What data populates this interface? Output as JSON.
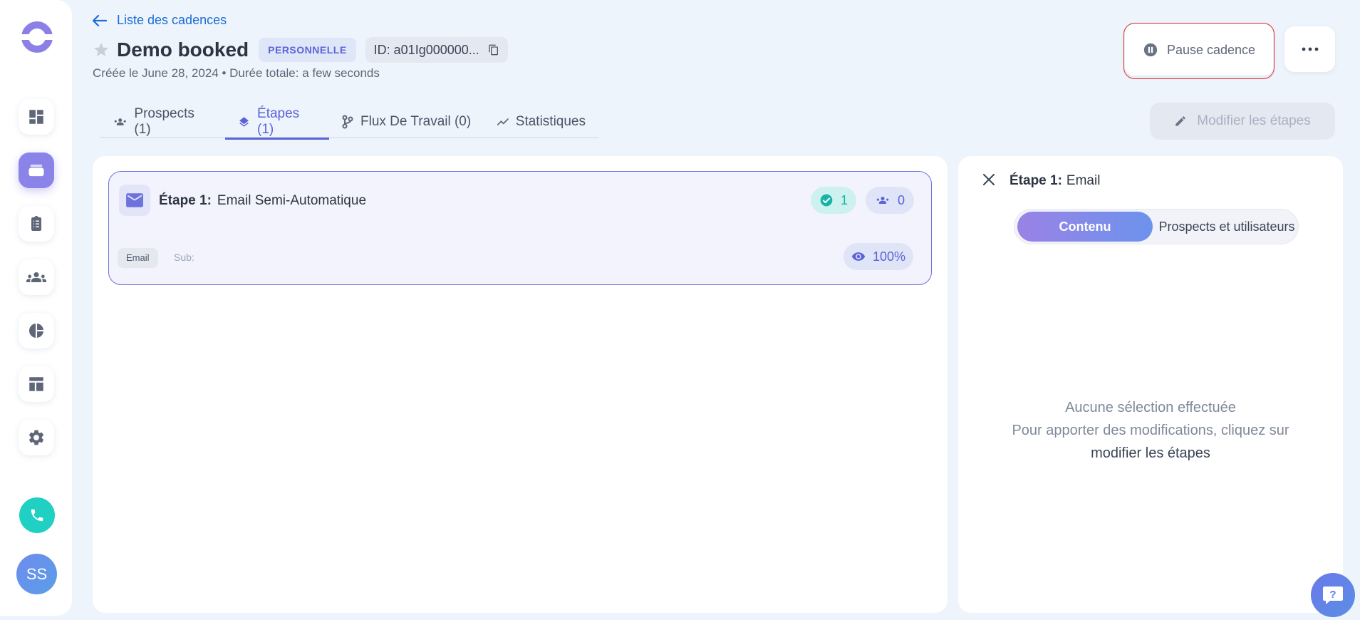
{
  "sidebar": {
    "items": [
      {
        "icon": "dashboard-icon"
      },
      {
        "icon": "cadences-icon",
        "active": true
      },
      {
        "icon": "clipboard-icon"
      },
      {
        "icon": "users-icon"
      },
      {
        "icon": "pie-chart-icon"
      },
      {
        "icon": "layout-icon"
      },
      {
        "icon": "gear-icon"
      }
    ],
    "call_icon": "phone-icon",
    "avatar_initials": "SS"
  },
  "header": {
    "back_label": "Liste des cadences",
    "title": "Demo booked",
    "badge": "PERSONNELLE",
    "id_label": "ID: a01Ig000000...",
    "meta": "Créée le June 28, 2024 • Durée totale: a few seconds",
    "pause_label": "Pause cadence",
    "modify_label": "Modifier les étapes"
  },
  "tabs": [
    {
      "label": "Prospects (1)",
      "icon": "users-icon"
    },
    {
      "label": "Étapes (1)",
      "icon": "layers-icon",
      "active": true
    },
    {
      "label": "Flux De Travail (0)",
      "icon": "branch-icon"
    },
    {
      "label": "Statistiques",
      "icon": "trend-icon"
    }
  ],
  "step": {
    "prefix": "Étape 1:",
    "name": "Email Semi-Automatique",
    "done_count": "1",
    "users_count": "0",
    "type_chip": "Email",
    "sub_label": "Sub:",
    "percent": "100%"
  },
  "right_panel": {
    "title_prefix": "Étape 1:",
    "title_value": "Email",
    "toggle_on": "Contenu",
    "toggle_off": "Prospects et utilisateurs",
    "empty_line1": "Aucune sélection effectuée",
    "empty_line2": "Pour apporter des modifications, cliquez sur",
    "empty_line3": "modifier les étapes"
  },
  "colors": {
    "accent": "#5b63d8",
    "link": "#1a6cd8",
    "teal": "#1fd0c3",
    "highlight_outline": "#e0322e"
  }
}
